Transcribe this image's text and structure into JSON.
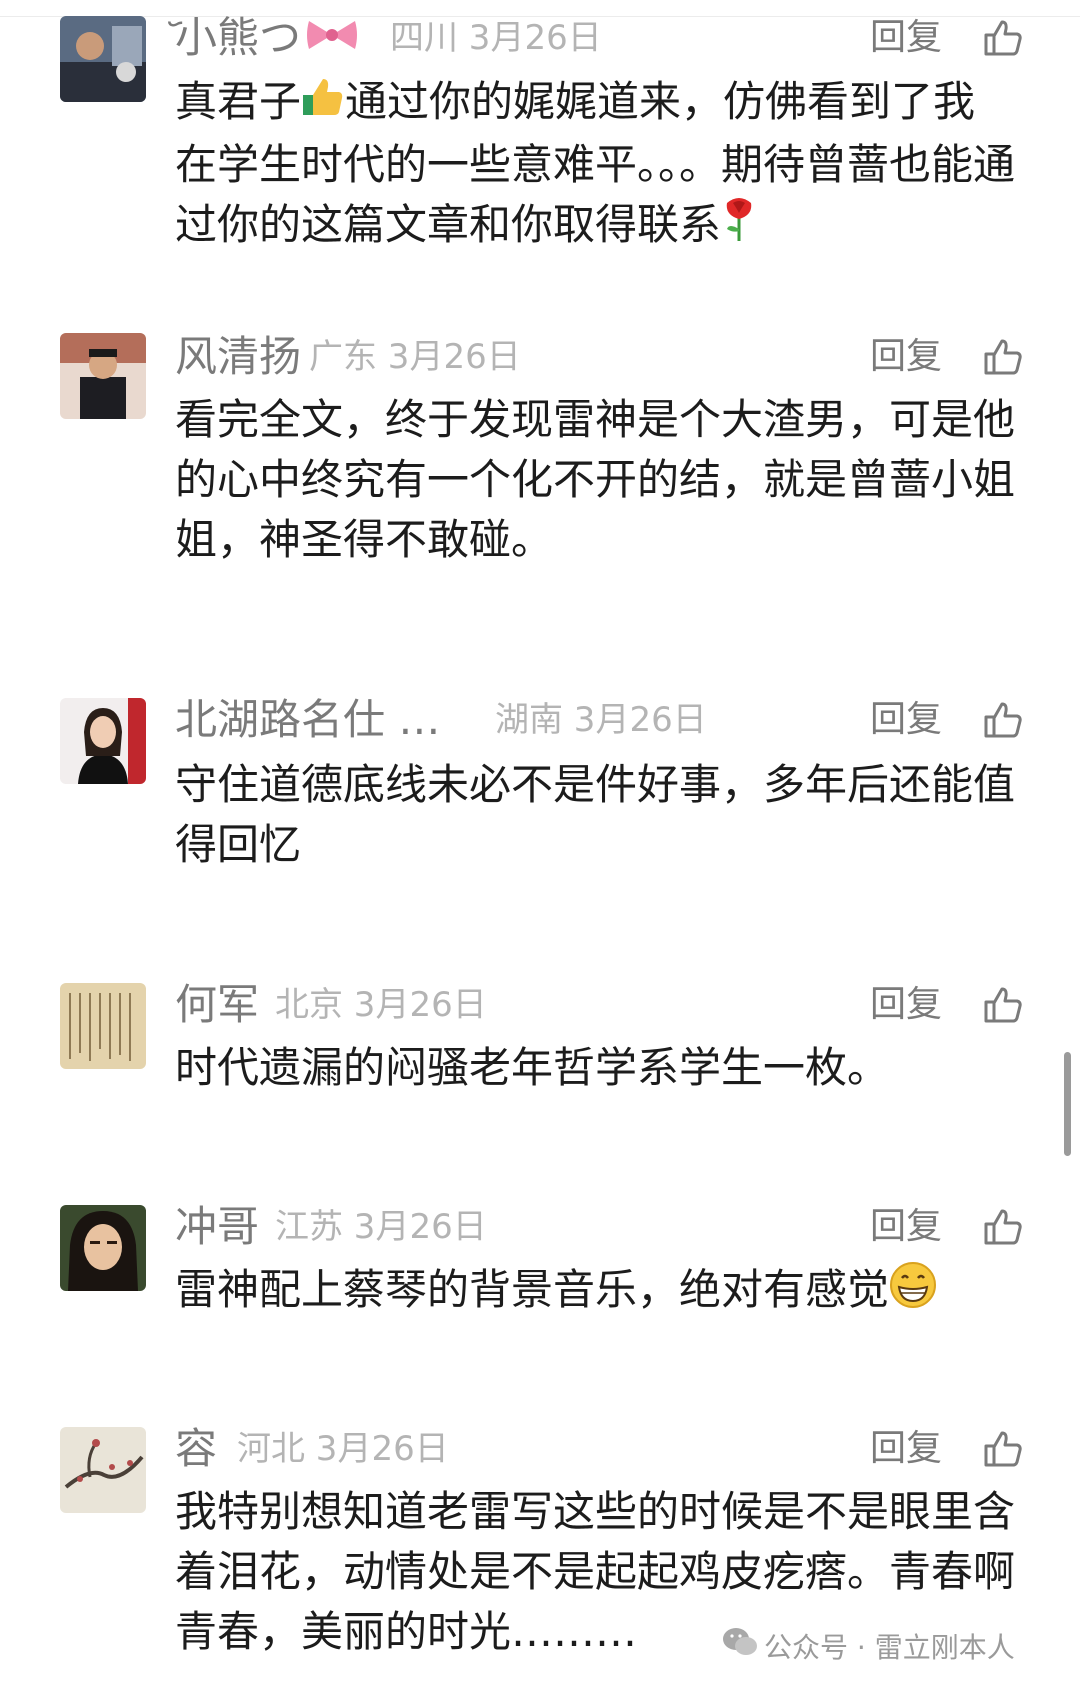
{
  "action_labels": {
    "reply": "回复"
  },
  "comments": [
    {
      "name": "᷃小熊つ",
      "name_emoji": "bow-emoji",
      "meta": "四川 3月26日",
      "text_a": "真君子",
      "text_emoji_1": "thumbs-up-emoji",
      "text_b": "通过你的娓娓道来，仿佛看到了我在学生时代的一些意难平。。。期待曾蔷也能通过你的这篇文章和你取得联系",
      "text_emoji_2": "rose-emoji"
    },
    {
      "name": "风清扬",
      "meta": "广东 3月26日",
      "text": "看完全文，终于发现雷神是个大渣男，可是他的心中终究有一个化不开的结，就是曾蔷小姐姐，神圣得不敢碰。"
    },
    {
      "name": "北湖路名仕 …",
      "meta": "湖南 3月26日",
      "text": "守住道德底线未必不是件好事，多年后还能值得回忆"
    },
    {
      "name": "何军",
      "meta": "北京 3月26日",
      "text": "时代遗漏的闷骚老年哲学系学生一枚。"
    },
    {
      "name": "冲哥",
      "meta": "江苏 3月26日",
      "text": "雷神配上蔡琴的背景音乐，绝对有感觉",
      "text_emoji": "grin-emoji"
    },
    {
      "name": "容",
      "meta": "河北 3月26日",
      "text": "我特别想知道老雷写这些的时候是不是眼里含着泪花，动情处是不是起起鸡皮疙瘩。青春啊青春，美丽的时光………"
    }
  ],
  "watermark": {
    "text": "公众号 · 雷立刚本人"
  },
  "colors": {
    "name": "#7a7a7a",
    "meta": "#b4b4b4",
    "text": "#1c1c1c"
  }
}
